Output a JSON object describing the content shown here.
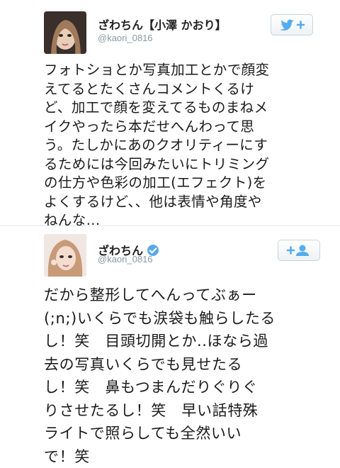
{
  "tweets": [
    {
      "name": "ざわちん【小澤 かおり】",
      "handle": "@kaori_0816",
      "verified": false,
      "follow_icon": "twitter-bird-follow-icon",
      "text": "フォトショとか写真加工とかで顔変\nえてるとたくさんコメントくるけ\nど、加工で顔を変えてるものまねメ\nイクやったら本だせへんわって思\nう。たしかにあのクオリティーにす\nるためには今回みたいにトリミング\nの仕方や色彩の加工(エフェクト)を\nよくするけど、、他は表情や角度や\nねんな..."
    },
    {
      "name": "ざわちん",
      "handle": "@kaori_0816",
      "verified": true,
      "follow_icon": "person-add-icon",
      "text": "だから整形してへんってぶぁー\n(;n;)いくらでも涙袋も触らしたる\nし！笑　目頭切開とか..ほなら過\n去の写真いくらでも見せたる\nし！笑　鼻もつまんだりぐりぐ\nりさせたるし！笑　早い話特殊\nライトで照らしても全然いい\nで！笑"
    }
  ],
  "colors": {
    "twitter_blue": "#55acee",
    "verified_blue": "#5aa9e6",
    "handle_gray": "#8899a6"
  }
}
